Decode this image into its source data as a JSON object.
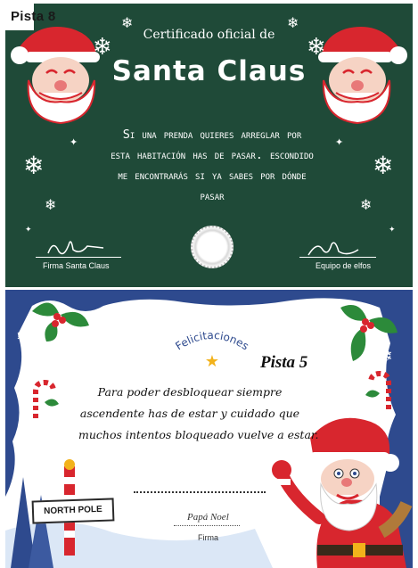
{
  "card_top": {
    "tag": "Pista 8",
    "subtitle": "Certificado oficial de",
    "title": "Santa Claus",
    "body_lines": [
      "Si una prenda quieres arreglar por",
      "esta habitación has de pasar. escondido",
      "me encontrarás si ya sabes por dónde",
      "pasar"
    ],
    "signature_left_label": "Firma Santa Claus",
    "signature_right_label": "Equipo de elfos",
    "colors": {
      "background": "#1f4a38",
      "text": "#ffffff",
      "santa_red": "#d8262e"
    }
  },
  "card_bottom": {
    "arc_title": "Felicitaciones",
    "tag": "Pista 5",
    "body_lines": [
      "Para poder desbloquear siempre",
      "ascendente has de estar y cuidado que",
      "muchos intentos bloqueado vuelve a estar."
    ],
    "signature_name": "Papá Noel",
    "signature_label": "Firma",
    "pole_sign": "NORTH POLE",
    "colors": {
      "paper": "#ffffff",
      "frame": "#2e4a8e",
      "accent_star": "#f2b21b",
      "santa_red": "#d8262e"
    }
  }
}
